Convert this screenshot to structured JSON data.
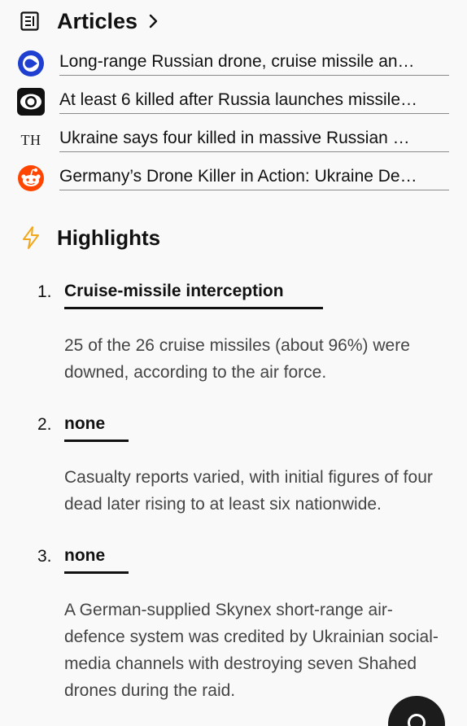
{
  "articles": {
    "title": "Articles",
    "items": [
      {
        "title": "Long-range Russian drone, cruise missile an…",
        "source_icon": "blue-circle-play-icon"
      },
      {
        "title": "At least 6 killed after Russia launches missile…",
        "source_icon": "cbs-eye-icon"
      },
      {
        "title": "Ukraine says four killed in massive Russian …",
        "source_icon": "th-monogram-icon",
        "icon_text": "TH"
      },
      {
        "title": "Germany’s Drone Killer in Action: Ukraine De…",
        "source_icon": "reddit-icon"
      }
    ]
  },
  "highlights": {
    "title": "Highlights",
    "items": [
      {
        "number": "1.",
        "title": "Cruise-missile interception",
        "body": "25 of the 26 cruise missiles (about 96%) were downed, according to the air force."
      },
      {
        "number": "2.",
        "title": "none",
        "body": "Casualty reports varied, with initial figures of four dead later rising to at least six nationwide."
      },
      {
        "number": "3.",
        "title": "none",
        "body": "A German-supplied Skynex short-range air-defence system was credited by Ukrainian social-media channels with destroying seven Shahed drones during the raid."
      }
    ]
  },
  "colors": {
    "accent_bolt": "#f2a81d",
    "blue_icon": "#1f3fd1",
    "reddit": "#ff4500"
  }
}
